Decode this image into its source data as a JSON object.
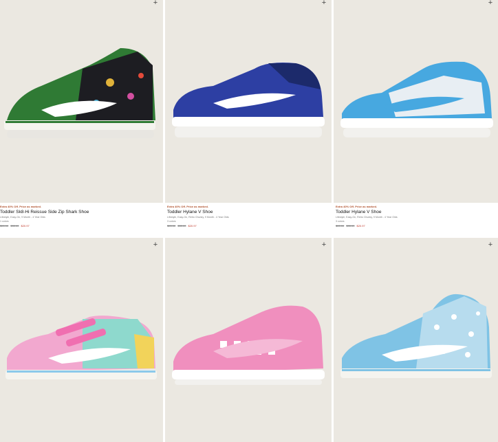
{
  "add_glyph": "+",
  "products": [
    {
      "promo": "Extra 40% Off. Price as marked.",
      "name": "Toddler Sk8-Hi Reissue Side Zip Shark Shoe",
      "desc": "Lifestyle, Easy-On, 9 Month - 4 Year Olds",
      "colors": "1 colors",
      "price_original": "$55.00",
      "price_sale": "$33.00",
      "price_final": "$20.97",
      "shoe_icon": "green-shark-hi-top-shoe"
    },
    {
      "promo": "Extra 40% Off. Price as marked.",
      "name": "Toddler Hylane V Shoe",
      "desc": "Lifestyle, Easy-On, Retro Chunky, 9 Month - 4 Year Olds",
      "colors": "3 colors",
      "price_original": "$55.00",
      "price_sale": "$33.00",
      "price_final": "$20.97",
      "shoe_icon": "blue-low-top-shoe"
    },
    {
      "promo": "Extra 40% Off. Price as marked.",
      "name": "Toddler Hylane V Shoe",
      "desc": "Lifestyle, Easy-On, Retro Chunky, 9 Month - 4 Year Olds",
      "colors": "3 colors",
      "price_original": "$55.00",
      "price_sale": "$33.00",
      "price_final": "$20.97",
      "shoe_icon": "light-blue-low-top-shoe"
    },
    {
      "shoe_icon": "glitter-pastel-velcro-shoe"
    },
    {
      "shoe_icon": "pink-checkerboard-shoe"
    },
    {
      "shoe_icon": "floral-blue-hi-top-shoe"
    }
  ]
}
